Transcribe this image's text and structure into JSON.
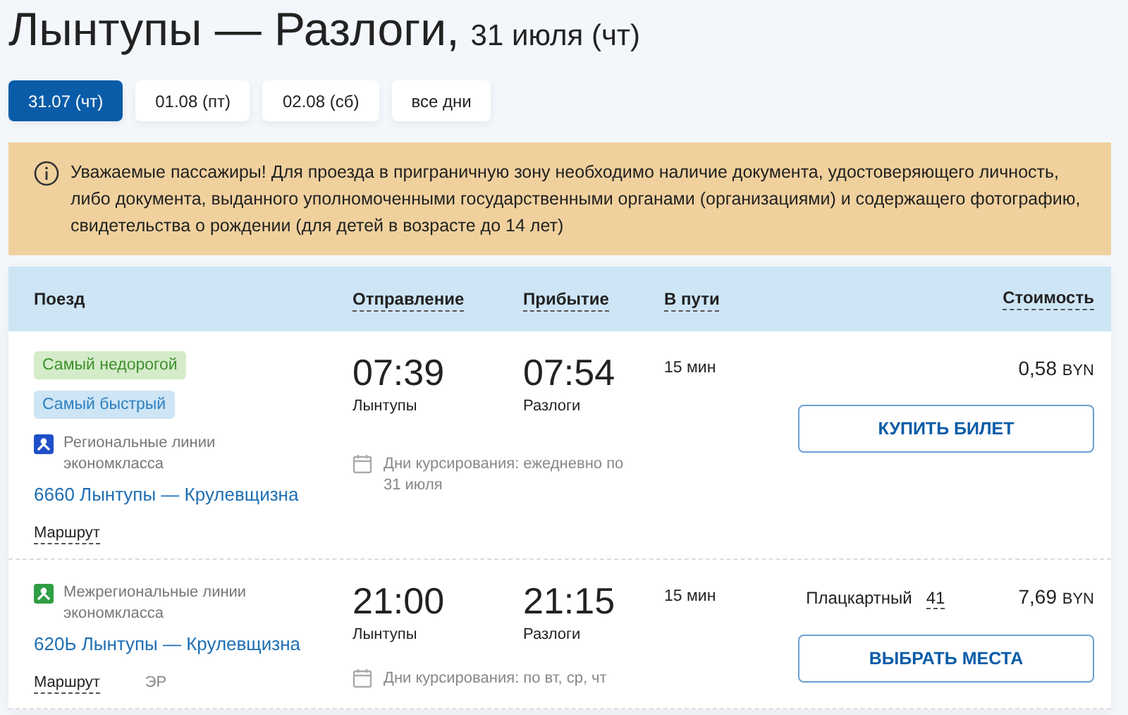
{
  "title": {
    "route": "Лынтупы — Разлоги,",
    "date": "31 июля (чт)"
  },
  "date_tabs": [
    {
      "label": "31.07 (чт)",
      "selected": true
    },
    {
      "label": "01.08 (пт)",
      "selected": false
    },
    {
      "label": "02.08 (сб)",
      "selected": false
    },
    {
      "label": "все дни",
      "selected": false
    }
  ],
  "notice": {
    "text": "Уважаемые пассажиры! Для проезда в приграничную зону необходимо наличие документа, удостоверяющего личность, либо документа, выданного уполномоченными государственными органами (организациями) и содержащего фотографию, свидетельства о рождении (для детей в возрасте до 14 лет)"
  },
  "table": {
    "columns": [
      "Поезд",
      "Отправление",
      "Прибытие",
      "В пути",
      "Стоимость"
    ],
    "rows": [
      {
        "badges": [
          {
            "label": "Самый недорогой",
            "color": "#d4ecc9"
          },
          {
            "label": "Самый быстрый",
            "color": "#cde5f5"
          }
        ],
        "operator": {
          "label": "Региональные линии экономкласса",
          "color": "#1e4fc8"
        },
        "train": "6660 Лынтупы — Крулевщизна",
        "route_link": "Маршрут",
        "departure": {
          "time": "07:39",
          "station": "Лынтупы"
        },
        "arrival": {
          "time": "07:54",
          "station": "Разлоги"
        },
        "duration": "15 мин",
        "days": "Дни курсирования: ежедневно по 31 июля",
        "price": "0,58",
        "currency": "BYN",
        "button": "КУПИТЬ БИЛЕТ"
      },
      {
        "operator": {
          "label": "Межрегиональные линии экономкласса",
          "color": "#2f9e44"
        },
        "train": "620Ь Лынтупы — Крулевщизна",
        "route_link": "Маршрут",
        "train_type": "ЭР",
        "departure": {
          "time": "21:00",
          "station": "Лынтупы"
        },
        "arrival": {
          "time": "21:15",
          "station": "Разлоги"
        },
        "duration": "15 мин",
        "days": "Дни курсирования: по вт, ср, чт",
        "seat_class": "Плацкартный",
        "seats": "41",
        "price": "7,69",
        "currency": "BYN",
        "button": "ВЫБРАТЬ МЕСТА"
      }
    ]
  }
}
